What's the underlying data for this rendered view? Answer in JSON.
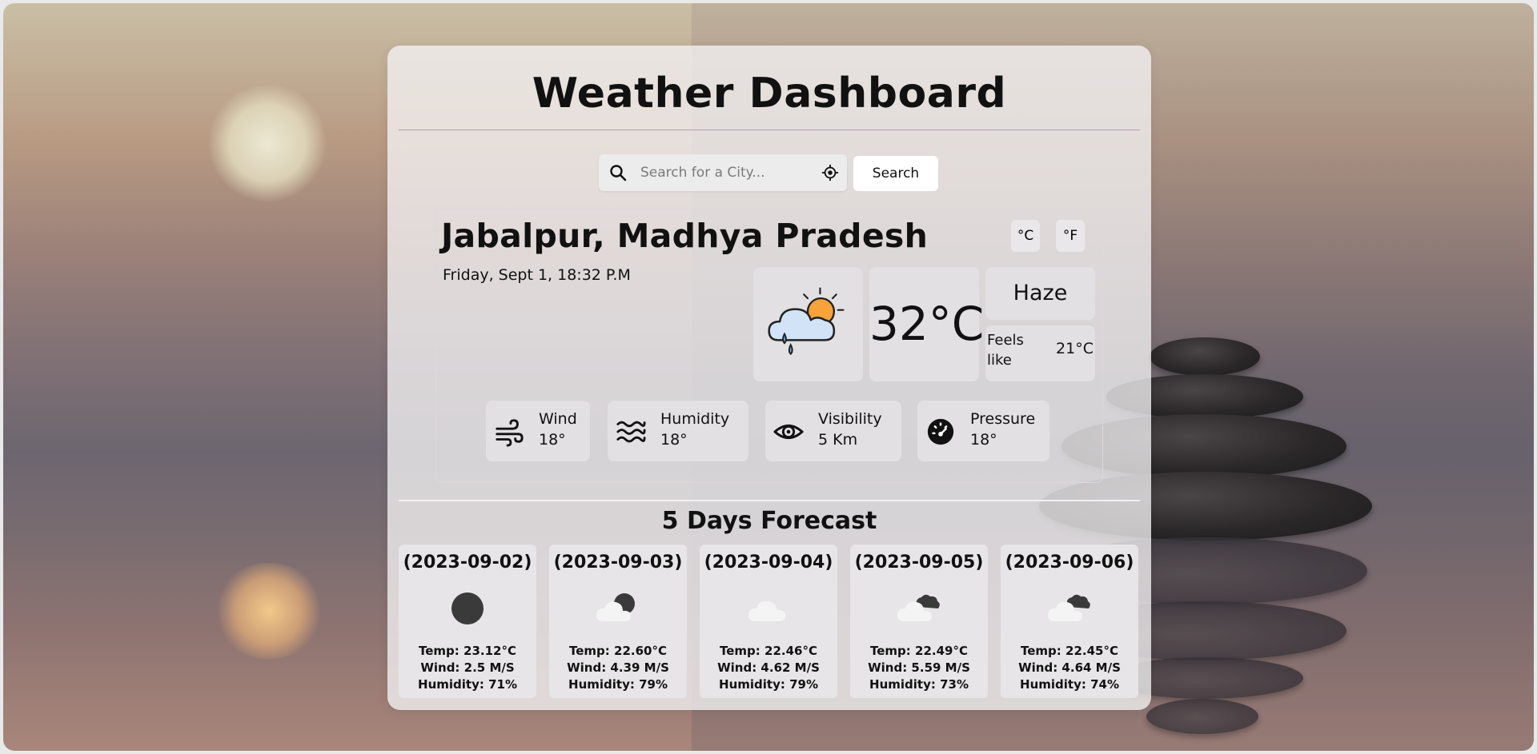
{
  "header": {
    "title": "Weather Dashboard"
  },
  "search": {
    "placeholder": "Search for a City...",
    "button_label": "Search"
  },
  "current": {
    "city": "Jabalpur, Madhya Pradesh",
    "datetime": "Friday, Sept 1, 18:32 P.M",
    "unit_c": "°C",
    "unit_f": "°F",
    "temperature": "32°C",
    "condition": "Haze",
    "feels_label": "Feels like",
    "feels_value": "21°C",
    "icon": "partly-cloudy-rain-icon"
  },
  "metrics": [
    {
      "label": "Wind",
      "value": "18°",
      "icon": "wind-icon"
    },
    {
      "label": "Humidity",
      "value": "18°",
      "icon": "humidity-waves-icon"
    },
    {
      "label": "Visibility",
      "value": "5 Km",
      "icon": "eye-icon"
    },
    {
      "label": "Pressure",
      "value": "18°",
      "icon": "gauge-icon"
    }
  ],
  "forecast": {
    "title": "5 Days Forecast",
    "days": [
      {
        "date": "(2023-09-02)",
        "temp": "Temp: 23.12°C",
        "wind": "Wind: 2.5 M/S",
        "humidity": "Humidity: 71%",
        "icon": "moon-icon"
      },
      {
        "date": "(2023-09-03)",
        "temp": "Temp: 22.60°C",
        "wind": "Wind: 4.39 M/S",
        "humidity": "Humidity: 79%",
        "icon": "moon-cloud-icon"
      },
      {
        "date": "(2023-09-04)",
        "temp": "Temp: 22.46°C",
        "wind": "Wind: 4.62 M/S",
        "humidity": "Humidity: 79%",
        "icon": "cloud-icon"
      },
      {
        "date": "(2023-09-05)",
        "temp": "Temp: 22.49°C",
        "wind": "Wind: 5.59 M/S",
        "humidity": "Humidity: 73%",
        "icon": "broken-clouds-icon"
      },
      {
        "date": "(2023-09-06)",
        "temp": "Temp: 22.45°C",
        "wind": "Wind: 4.64 M/S",
        "humidity": "Humidity: 74%",
        "icon": "broken-clouds-icon"
      }
    ]
  },
  "colors": {
    "panel": "#f4f2f4",
    "tile": "#e2e0e2",
    "text": "#111111",
    "sun_icon": "#f7a23b",
    "cloud_icon": "#cfe0f5"
  }
}
